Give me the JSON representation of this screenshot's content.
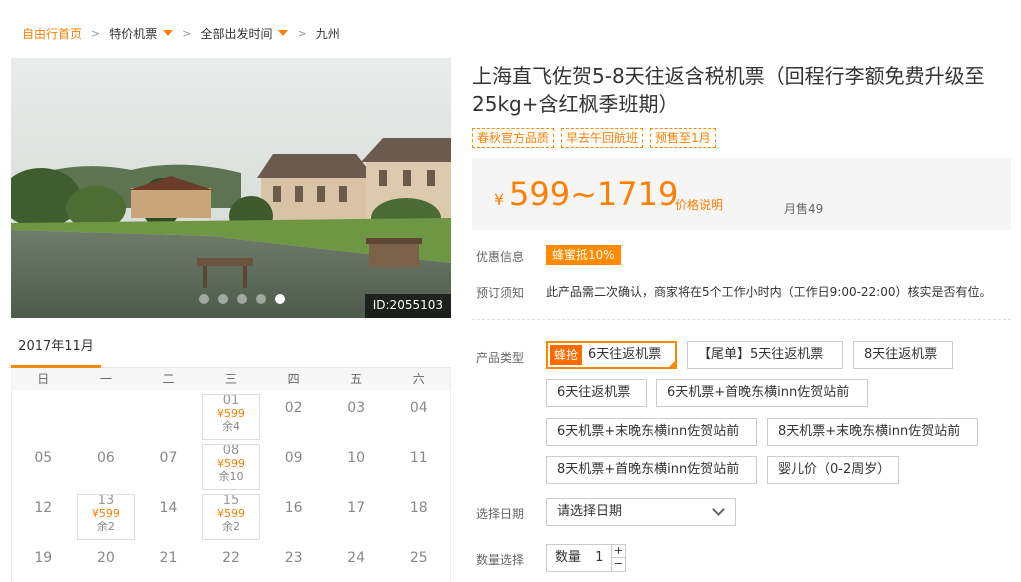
{
  "breadcrumb": {
    "home": "自由行首页",
    "cat": "特价机票",
    "time": "全部出发时间",
    "current": "九州"
  },
  "photo": {
    "id_label": "ID:2055103",
    "slide_count": 5,
    "active_slide": 4
  },
  "calendar": {
    "month_tab": "2017年11月",
    "weekdays": [
      "日",
      "一",
      "二",
      "三",
      "四",
      "五",
      "六"
    ],
    "weeks": [
      [
        {
          "d": ""
        },
        {
          "d": ""
        },
        {
          "d": ""
        },
        {
          "d": "01",
          "price": "¥599",
          "left": "余4"
        },
        {
          "d": "02"
        },
        {
          "d": "03"
        },
        {
          "d": "04"
        }
      ],
      [
        {
          "d": "05"
        },
        {
          "d": "06"
        },
        {
          "d": "07"
        },
        {
          "d": "08",
          "price": "¥599",
          "left": "余10"
        },
        {
          "d": "09"
        },
        {
          "d": "10"
        },
        {
          "d": "11"
        }
      ],
      [
        {
          "d": "12"
        },
        {
          "d": "13",
          "price": "¥599",
          "left": "余2"
        },
        {
          "d": "14"
        },
        {
          "d": "15",
          "price": "¥599",
          "left": "余2"
        },
        {
          "d": "16"
        },
        {
          "d": "17"
        },
        {
          "d": "18"
        }
      ],
      [
        {
          "d": "19"
        },
        {
          "d": "20"
        },
        {
          "d": "21"
        },
        {
          "d": "22"
        },
        {
          "d": "23"
        },
        {
          "d": "24"
        },
        {
          "d": "25"
        }
      ]
    ]
  },
  "product": {
    "title": "上海直飞佐贺5-8天往返含税机票（回程行李额免费升级至25kg+含红枫季班期）",
    "tags": [
      "春秋官方品质",
      "早去午回航班",
      "预售至1月"
    ],
    "yen": "¥",
    "price_range": "599~1719",
    "price_note": "价格说明",
    "monthly_sales": "月售49"
  },
  "info": {
    "promo_label": "优惠信息",
    "promo_badge": "蜂蜜抵10%",
    "notice_label": "预订须知",
    "notice_text": "此产品需二次确认，商家将在5个工作小时内（工作日9:00-22:00）核实是否有位。"
  },
  "options": {
    "label": "产品类型",
    "hot_badge": "蜂抢",
    "items": [
      "6天往返机票",
      "【尾单】5天往返机票",
      "8天往返机票",
      "6天往返机票",
      "6天机票+首晚东横inn佐贺站前",
      "6天机票+末晚东横inn佐贺站前",
      "8天机票+末晚东横inn佐贺站前",
      "8天机票+首晚东横inn佐贺站前",
      "婴儿价（0-2周岁）"
    ]
  },
  "date": {
    "label": "选择日期",
    "placeholder": "请选择日期"
  },
  "quantity": {
    "label": "数量选择",
    "field_label": "数量",
    "value": "1",
    "plus": "+",
    "minus": "−"
  },
  "colors": {
    "accent": "#ff8a00",
    "price": "#ff7f00"
  }
}
